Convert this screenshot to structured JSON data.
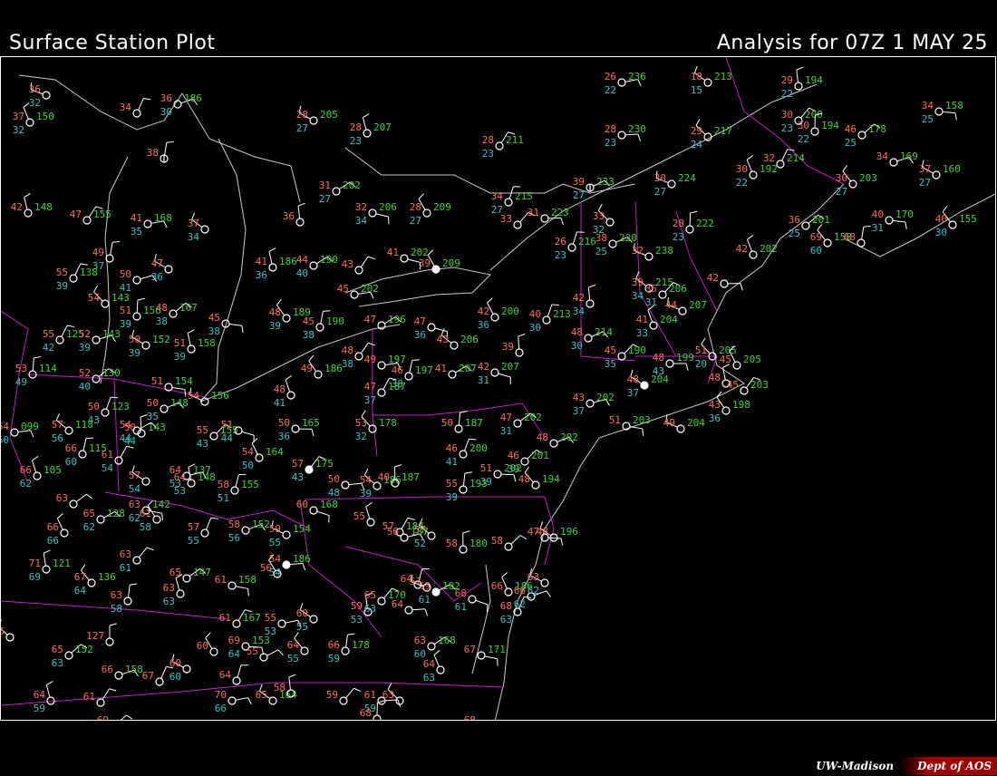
{
  "header": {
    "title": "Surface Station Plot",
    "analysis": "Analysis for 07Z  1 MAY 25"
  },
  "credit": {
    "institution": "UW-Madison",
    "department": "Dept of AOS"
  },
  "colors": {
    "temperature": "#ff6b5a",
    "dewpoint": "#2ec4c4",
    "pressure": "#39d62c",
    "state_borders": "#c020c0",
    "coastlines": "#c8c8c8",
    "background": "#000000"
  },
  "stations": [
    {
      "t": "36",
      "td": "32",
      "p": "",
      "cover": "clear"
    },
    {
      "t": "37",
      "td": "32",
      "p": "150",
      "cover": "clear"
    },
    {
      "t": "34",
      "td": "",
      "p": "",
      "cover": "clear"
    },
    {
      "t": "36",
      "td": "30",
      "p": "186",
      "cover": "clear"
    },
    {
      "t": "28",
      "td": "27",
      "p": "205",
      "cover": "clear"
    },
    {
      "t": "28",
      "td": "23",
      "p": "207",
      "cover": "clear"
    },
    {
      "t": "28",
      "td": "23",
      "p": "211",
      "cover": "clear"
    },
    {
      "t": "26",
      "td": "22",
      "p": "236",
      "cover": "clear"
    },
    {
      "t": "18",
      "td": "15",
      "p": "213",
      "cover": "clear"
    },
    {
      "t": "29",
      "td": "22",
      "p": "194",
      "cover": "clear"
    },
    {
      "t": "30",
      "td": "23",
      "p": "200",
      "cover": "clear"
    },
    {
      "t": "28",
      "td": "23",
      "p": "230",
      "cover": "clear"
    },
    {
      "t": "29",
      "td": "24",
      "p": "217",
      "cover": "clear"
    },
    {
      "t": "30",
      "td": "22",
      "p": "194",
      "cover": "clear"
    },
    {
      "t": "46",
      "td": "25",
      "p": "178",
      "cover": "clear"
    },
    {
      "t": "34",
      "td": "25",
      "p": "158",
      "cover": "clear"
    },
    {
      "t": "30",
      "td": "27",
      "p": "203",
      "cover": "clear"
    },
    {
      "t": "38",
      "td": "",
      "p": "",
      "cover": "few"
    },
    {
      "t": "31",
      "td": "27",
      "p": "202",
      "cover": "clear"
    },
    {
      "t": "32",
      "td": "34",
      "p": "206",
      "cover": "clear"
    },
    {
      "t": "28",
      "td": "27",
      "p": "209",
      "cover": "clear"
    },
    {
      "t": "34",
      "td": "27",
      "p": "215",
      "cover": "clear"
    },
    {
      "t": "39",
      "td": "27",
      "p": "233",
      "cover": "few"
    },
    {
      "t": "30",
      "td": "27",
      "p": "224",
      "cover": "clear"
    },
    {
      "t": "30",
      "td": "22",
      "p": "192",
      "cover": "clear"
    },
    {
      "t": "32",
      "td": "",
      "p": "214",
      "cover": "clear"
    },
    {
      "t": "34",
      "td": "",
      "p": "169",
      "cover": "clear"
    },
    {
      "t": "37",
      "td": "27",
      "p": "160",
      "cover": "clear"
    },
    {
      "t": "42",
      "td": "",
      "p": "148",
      "cover": "clear"
    },
    {
      "t": "47",
      "td": "",
      "p": "155",
      "cover": "clear"
    },
    {
      "t": "41",
      "td": "35",
      "p": "168",
      "cover": "clear"
    },
    {
      "t": "37",
      "td": "34",
      "p": "",
      "cover": "clear"
    },
    {
      "t": "36",
      "td": "",
      "p": "",
      "cover": "clear"
    },
    {
      "t": "33",
      "td": "",
      "p": "",
      "cover": "clear"
    },
    {
      "t": "31",
      "td": "",
      "p": "223",
      "cover": "clear"
    },
    {
      "t": "33",
      "td": "32",
      "p": "",
      "cover": "clear"
    },
    {
      "t": "28",
      "td": "23",
      "p": "222",
      "cover": "clear"
    },
    {
      "t": "36",
      "td": "25",
      "p": "201",
      "cover": "clear"
    },
    {
      "t": "40",
      "td": "31",
      "p": "170",
      "cover": "clear"
    },
    {
      "t": "40",
      "td": "30",
      "p": "155",
      "cover": "clear"
    },
    {
      "t": "49",
      "td": "37",
      "p": "",
      "cover": "clear"
    },
    {
      "t": "44",
      "td": "40",
      "p": "190",
      "cover": "clear"
    },
    {
      "t": "41",
      "td": "",
      "p": "202",
      "cover": "clear"
    },
    {
      "t": "39",
      "td": "",
      "p": "209",
      "cover": "overcast"
    },
    {
      "t": "26",
      "td": "23",
      "p": "216",
      "cover": "clear"
    },
    {
      "t": "38",
      "td": "25",
      "p": "220",
      "cover": "clear"
    },
    {
      "t": "32",
      "td": "",
      "p": "238",
      "cover": "clear"
    },
    {
      "t": "42",
      "td": "",
      "p": "202",
      "cover": "clear"
    },
    {
      "t": "55",
      "td": "39",
      "p": "138",
      "cover": "clear"
    },
    {
      "t": "50",
      "td": "41",
      "p": "",
      "cover": "clear"
    },
    {
      "t": "47",
      "td": "36",
      "p": "",
      "cover": "clear"
    },
    {
      "t": "41",
      "td": "36",
      "p": "186",
      "cover": "clear"
    },
    {
      "t": "43",
      "td": "",
      "p": "",
      "cover": "clear"
    },
    {
      "t": "45",
      "td": "",
      "p": "202",
      "cover": "clear"
    },
    {
      "t": "39",
      "td": "34",
      "p": "215",
      "cover": "clear"
    },
    {
      "t": "42",
      "td": "34",
      "p": "",
      "cover": "clear"
    },
    {
      "t": "35",
      "td": "31",
      "p": "206",
      "cover": "clear"
    },
    {
      "t": "42",
      "td": "",
      "p": "",
      "cover": "clear"
    },
    {
      "t": "54",
      "td": "",
      "p": "143",
      "cover": "clear"
    },
    {
      "t": "51",
      "td": "39",
      "p": "156",
      "cover": "clear"
    },
    {
      "t": "48",
      "td": "38",
      "p": "167",
      "cover": "clear"
    },
    {
      "t": "45",
      "td": "38",
      "p": "",
      "cover": "clear"
    },
    {
      "t": "48",
      "td": "39",
      "p": "189",
      "cover": "clear"
    },
    {
      "t": "45",
      "td": "38",
      "p": "190",
      "cover": "clear"
    },
    {
      "t": "47",
      "td": "",
      "p": "196",
      "cover": "clear"
    },
    {
      "t": "47",
      "td": "36",
      "p": "",
      "cover": "clear"
    },
    {
      "t": "42",
      "td": "36",
      "p": "200",
      "cover": "clear"
    },
    {
      "t": "40",
      "td": "30",
      "p": "213",
      "cover": "clear"
    },
    {
      "t": "48",
      "td": "30",
      "p": "214",
      "cover": "clear"
    },
    {
      "t": "44",
      "td": "",
      "p": "207",
      "cover": "clear"
    },
    {
      "t": "41",
      "td": "33",
      "p": "204",
      "cover": "clear"
    },
    {
      "t": "55",
      "td": "42",
      "p": "125",
      "cover": "clear"
    },
    {
      "t": "52",
      "td": "39",
      "p": "143",
      "cover": "clear"
    },
    {
      "t": "50",
      "td": "39",
      "p": "152",
      "cover": "clear"
    },
    {
      "t": "51",
      "td": "39",
      "p": "158",
      "cover": "clear"
    },
    {
      "t": "48",
      "td": "38",
      "p": "",
      "cover": "clear"
    },
    {
      "t": "49",
      "td": "",
      "p": "197",
      "cover": "clear"
    },
    {
      "t": "43",
      "td": "",
      "p": "206",
      "cover": "clear"
    },
    {
      "t": "39",
      "td": "",
      "p": "",
      "cover": "clear"
    },
    {
      "t": "45",
      "td": "35",
      "p": "190",
      "cover": "clear"
    },
    {
      "t": "48",
      "td": "43",
      "p": "199",
      "cover": "clear"
    },
    {
      "t": "51",
      "td": "20",
      "p": "205",
      "cover": "clear"
    },
    {
      "t": "53",
      "td": "49",
      "p": "114",
      "cover": "clear"
    },
    {
      "t": "52",
      "td": "40",
      "p": "130",
      "cover": "clear"
    },
    {
      "t": "51",
      "td": "",
      "p": "154",
      "cover": "clear"
    },
    {
      "t": "49",
      "td": "",
      "p": "186",
      "cover": "clear"
    },
    {
      "t": "46",
      "td": "38",
      "p": "197",
      "cover": "clear"
    },
    {
      "t": "41",
      "td": "",
      "p": "207",
      "cover": "clear"
    },
    {
      "t": "42",
      "td": "31",
      "p": "207",
      "cover": "clear"
    },
    {
      "t": "45",
      "td": "",
      "p": "205",
      "cover": "clear"
    },
    {
      "t": "50",
      "td": "43",
      "p": "123",
      "cover": "clear"
    },
    {
      "t": "50",
      "td": "35",
      "p": "148",
      "cover": "clear"
    },
    {
      "t": "54",
      "td": "",
      "p": "156",
      "cover": "clear"
    },
    {
      "t": "48",
      "td": "41",
      "p": "",
      "cover": "clear"
    },
    {
      "t": "47",
      "td": "37",
      "p": "187",
      "cover": "clear"
    },
    {
      "t": "43",
      "td": "37",
      "p": "202",
      "cover": "clear"
    },
    {
      "t": "48",
      "td": "37",
      "p": "204",
      "cover": "overcast"
    },
    {
      "t": "48",
      "td": "",
      "p": "",
      "cover": "clear"
    },
    {
      "t": "45",
      "td": "",
      "p": "203",
      "cover": "clear"
    },
    {
      "t": "64",
      "td": "60",
      "p": "099",
      "cover": "clear"
    },
    {
      "t": "57",
      "td": "56",
      "p": "118",
      "cover": "clear"
    },
    {
      "t": "50",
      "td": "44",
      "p": "143",
      "cover": "clear"
    },
    {
      "t": "55",
      "td": "43",
      "p": "155",
      "cover": "clear"
    },
    {
      "t": "50",
      "td": "36",
      "p": "165",
      "cover": "clear"
    },
    {
      "t": "53",
      "td": "32",
      "p": "178",
      "cover": "clear"
    },
    {
      "t": "50",
      "td": "",
      "p": "187",
      "cover": "clear"
    },
    {
      "t": "47",
      "td": "31",
      "p": "202",
      "cover": "clear"
    },
    {
      "t": "51",
      "td": "",
      "p": "203",
      "cover": "clear"
    },
    {
      "t": "43",
      "td": "36",
      "p": "198",
      "cover": "clear"
    },
    {
      "t": "66",
      "td": "60",
      "p": "115",
      "cover": "clear"
    },
    {
      "t": "54",
      "td": "44",
      "p": "",
      "cover": "clear"
    },
    {
      "t": "51",
      "td": "44",
      "p": "",
      "cover": "clear"
    },
    {
      "t": "54",
      "td": "50",
      "p": "164",
      "cover": "clear"
    },
    {
      "t": "46",
      "td": "41",
      "p": "200",
      "cover": "clear"
    },
    {
      "t": "48",
      "td": "",
      "p": "202",
      "cover": "clear"
    },
    {
      "t": "49",
      "td": "",
      "p": "204",
      "cover": "clear"
    },
    {
      "t": "66",
      "td": "62",
      "p": "105",
      "cover": "clear"
    },
    {
      "t": "61",
      "td": "54",
      "p": "",
      "cover": "clear"
    },
    {
      "t": "64",
      "td": "53",
      "p": "137",
      "cover": "clear"
    },
    {
      "t": "57",
      "td": "54",
      "p": "",
      "cover": "clear"
    },
    {
      "t": "64",
      "td": "53",
      "p": "148",
      "cover": "clear"
    },
    {
      "t": "57",
      "td": "43",
      "p": "175",
      "cover": "overcast"
    },
    {
      "t": "50",
      "td": "48",
      "p": "",
      "cover": "clear"
    },
    {
      "t": "54",
      "td": "39",
      "p": "186",
      "cover": "clear"
    },
    {
      "t": "40",
      "td": "",
      "p": "187",
      "cover": "clear"
    },
    {
      "t": "46",
      "td": "39",
      "p": "201",
      "cover": "clear"
    },
    {
      "t": "51",
      "td": "39",
      "p": "202",
      "cover": "clear"
    },
    {
      "t": "48",
      "td": "",
      "p": "194",
      "cover": "clear"
    },
    {
      "t": "55",
      "td": "39",
      "p": "193",
      "cover": "clear"
    },
    {
      "t": "63",
      "td": "",
      "p": "",
      "cover": "clear"
    },
    {
      "t": "63",
      "td": "62",
      "p": "142",
      "cover": "clear"
    },
    {
      "t": "61",
      "td": "58",
      "p": "",
      "cover": "clear"
    },
    {
      "t": "58",
      "td": "51",
      "p": "155",
      "cover": "clear"
    },
    {
      "t": "65",
      "td": "62",
      "p": "128",
      "cover": "clear"
    },
    {
      "t": "60",
      "td": "",
      "p": "168",
      "cover": "clear"
    },
    {
      "t": "66",
      "td": "66",
      "p": "",
      "cover": "clear"
    },
    {
      "t": "57",
      "td": "55",
      "p": "",
      "cover": "clear"
    },
    {
      "t": "58",
      "td": "56",
      "p": "152",
      "cover": "clear"
    },
    {
      "t": "59",
      "td": "55",
      "p": "154",
      "cover": "clear"
    },
    {
      "t": "55",
      "td": "",
      "p": "",
      "cover": "clear"
    },
    {
      "t": "57",
      "td": "",
      "p": "184",
      "cover": "clear"
    },
    {
      "t": "56",
      "td": "",
      "p": "187",
      "cover": "clear"
    },
    {
      "t": "48",
      "td": "",
      "p": "196",
      "cover": "clear"
    },
    {
      "t": "71",
      "td": "69",
      "p": "121",
      "cover": "clear"
    },
    {
      "t": "63",
      "td": "61",
      "p": "",
      "cover": "clear"
    },
    {
      "t": "54",
      "td": "54",
      "p": "186",
      "cover": "overcast"
    },
    {
      "t": "57",
      "td": "52",
      "p": "",
      "cover": "clear"
    },
    {
      "t": "58",
      "td": "",
      "p": "180",
      "cover": "clear"
    },
    {
      "t": "58",
      "td": "",
      "p": "",
      "cover": "clear"
    },
    {
      "t": "47",
      "td": "",
      "p": "",
      "cover": "clear"
    },
    {
      "t": "67",
      "td": "64",
      "p": "136",
      "cover": "clear"
    },
    {
      "t": "63",
      "td": "58",
      "p": "",
      "cover": "clear"
    },
    {
      "t": "65",
      "td": "",
      "p": "147",
      "cover": "clear"
    },
    {
      "t": "61",
      "td": "",
      "p": "158",
      "cover": "clear"
    },
    {
      "t": "56",
      "td": "",
      "p": "",
      "cover": "clear"
    },
    {
      "t": "64",
      "td": "",
      "p": "",
      "cover": "clear"
    },
    {
      "t": "69",
      "td": "61",
      "p": "182",
      "cover": "overcast"
    },
    {
      "t": "68",
      "td": "61",
      "p": "",
      "cover": "clear"
    },
    {
      "t": "66",
      "td": "",
      "p": "186",
      "cover": "clear"
    },
    {
      "t": "68",
      "td": "63",
      "p": "",
      "cover": "clear"
    },
    {
      "t": "66",
      "td": "62",
      "p": "",
      "cover": "clear"
    },
    {
      "t": "63",
      "td": "62",
      "p": "",
      "cover": "clear"
    },
    {
      "t": "63",
      "td": "63",
      "p": "",
      "cover": "clear"
    },
    {
      "t": "61",
      "td": "",
      "p": "167",
      "cover": "clear"
    },
    {
      "t": "55",
      "td": "53",
      "p": "",
      "cover": "clear"
    },
    {
      "t": "60",
      "td": "55",
      "p": "",
      "cover": "clear"
    },
    {
      "t": "59",
      "td": "53",
      "p": "",
      "cover": "clear"
    },
    {
      "t": "65",
      "td": "63",
      "p": "170",
      "cover": "clear"
    },
    {
      "t": "64",
      "td": "",
      "p": "",
      "cover": "clear"
    },
    {
      "t": "65",
      "td": "",
      "p": "",
      "cover": "clear"
    },
    {
      "t": "127",
      "td": "",
      "p": "",
      "cover": "clear"
    },
    {
      "t": "65",
      "td": "63",
      "p": "152",
      "cover": "clear"
    },
    {
      "t": "69",
      "td": "64",
      "p": "153",
      "cover": "clear"
    },
    {
      "t": "64",
      "td": "55",
      "p": "",
      "cover": "clear"
    },
    {
      "t": "66",
      "td": "59",
      "p": "178",
      "cover": "clear"
    },
    {
      "t": "63",
      "td": "60",
      "p": "168",
      "cover": "clear"
    },
    {
      "t": "67",
      "td": "",
      "p": "171",
      "cover": "clear"
    },
    {
      "t": "60",
      "td": "",
      "p": "",
      "cover": "clear"
    },
    {
      "t": "64",
      "td": "",
      "p": "",
      "cover": "clear"
    },
    {
      "t": "55",
      "td": "",
      "p": "",
      "cover": "clear"
    },
    {
      "t": "57",
      "td": "",
      "p": "",
      "cover": "clear"
    },
    {
      "t": "64",
      "td": "63",
      "p": "",
      "cover": "clear"
    },
    {
      "t": "67",
      "td": "",
      "p": "",
      "cover": "clear"
    },
    {
      "t": "66",
      "td": "",
      "p": "158",
      "cover": "clear"
    },
    {
      "t": "60",
      "td": "60",
      "p": "",
      "cover": "clear"
    },
    {
      "t": "64",
      "td": "59",
      "p": "",
      "cover": "clear"
    },
    {
      "t": "61",
      "td": "",
      "p": "",
      "cover": "clear"
    },
    {
      "t": "70",
      "td": "66",
      "p": "",
      "cover": "clear"
    },
    {
      "t": "65",
      "td": "",
      "p": "164",
      "cover": "clear"
    },
    {
      "t": "58",
      "td": "",
      "p": "",
      "cover": "clear"
    },
    {
      "t": "59",
      "td": "",
      "p": "",
      "cover": "clear"
    },
    {
      "t": "61",
      "td": "59",
      "p": "",
      "cover": "clear"
    },
    {
      "t": "63",
      "td": "",
      "p": "",
      "cover": "clear"
    },
    {
      "t": "68",
      "td": "",
      "p": "",
      "cover": "clear"
    },
    {
      "t": "69",
      "td": "66",
      "p": "",
      "cover": "clear"
    },
    {
      "t": "68",
      "td": "",
      "p": "",
      "cover": "clear"
    },
    {
      "t": "69",
      "td": "60",
      "p": "158",
      "cover": "clear"
    },
    {
      "t": "68",
      "td": "",
      "p": "",
      "cover": "clear"
    }
  ]
}
